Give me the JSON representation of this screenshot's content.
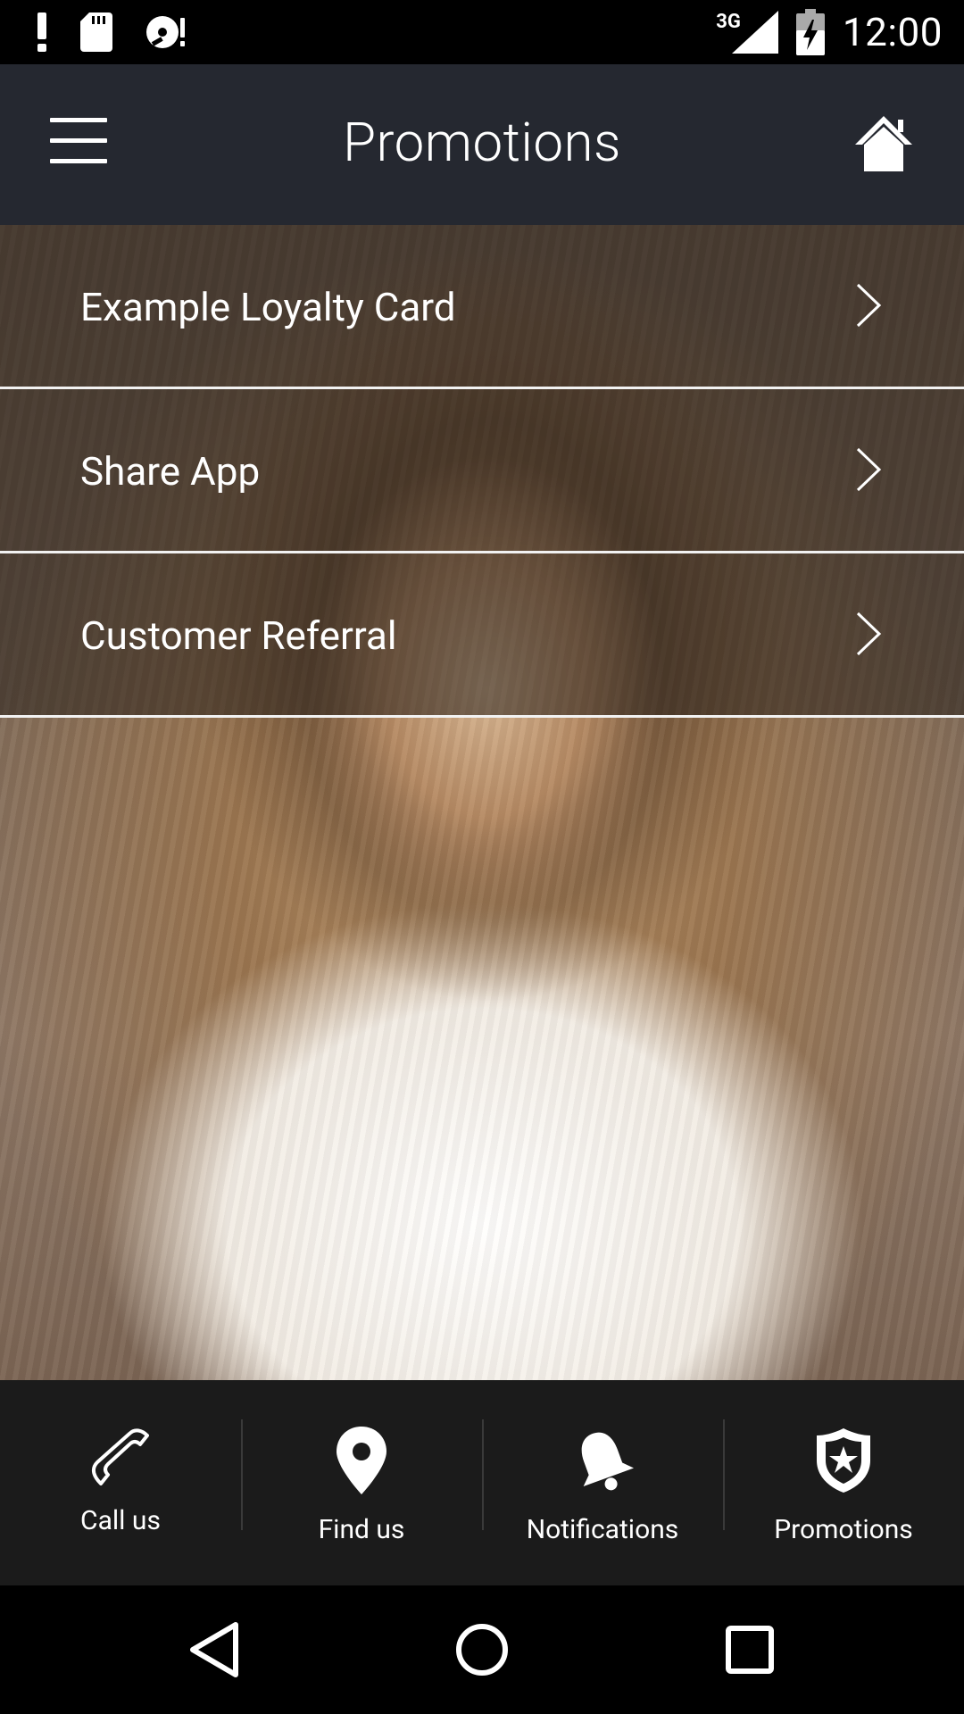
{
  "status_bar": {
    "network": "3G",
    "time": "12:00"
  },
  "app_bar": {
    "title": "Promotions"
  },
  "promotions": [
    {
      "label": "Example Loyalty Card"
    },
    {
      "label": "Share App"
    },
    {
      "label": "Customer Referral"
    }
  ],
  "tabs": [
    {
      "label": "Call us",
      "icon": "phone-icon"
    },
    {
      "label": "Find us",
      "icon": "map-pin-icon"
    },
    {
      "label": "Notifications",
      "icon": "bell-icon"
    },
    {
      "label": "Promotions",
      "icon": "shield-star-icon"
    }
  ],
  "colors": {
    "app_bar_bg": "#252830",
    "tab_bar_bg": "#1b1b1b",
    "text": "#ffffff"
  }
}
